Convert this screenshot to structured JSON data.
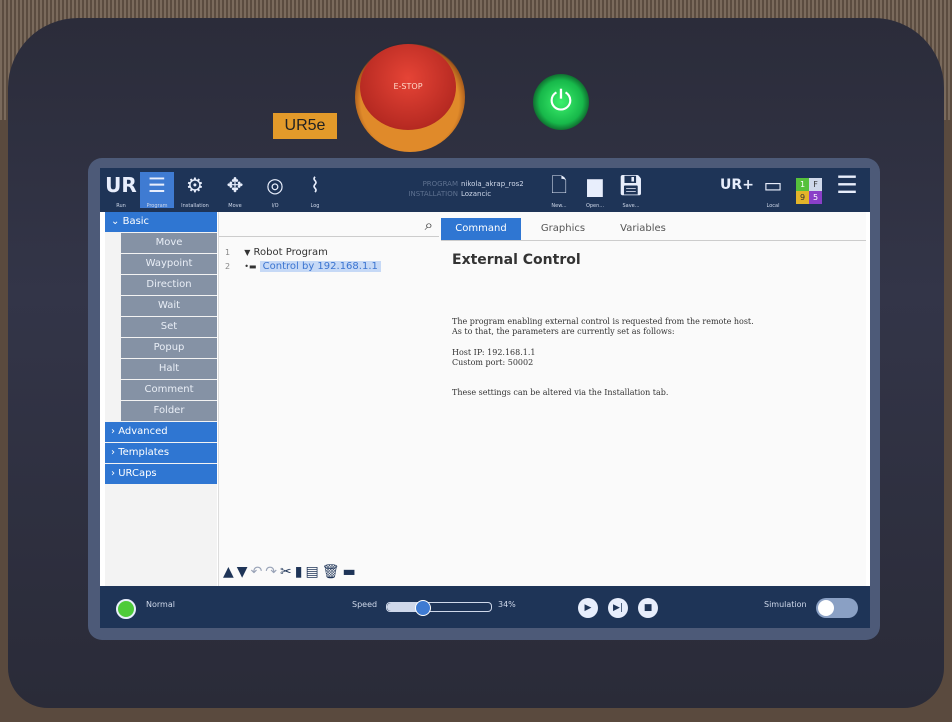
{
  "hardware": {
    "estop_label": "E-STOP",
    "model_label": "UR5e",
    "power_icon": "power-icon"
  },
  "header": {
    "tabs": [
      {
        "label": "Run",
        "icon": "ur-logo-icon"
      },
      {
        "label": "Program",
        "icon": "program-icon"
      },
      {
        "label": "Installation",
        "icon": "installation-icon"
      },
      {
        "label": "Move",
        "icon": "move-icon"
      },
      {
        "label": "I/O",
        "icon": "io-icon"
      },
      {
        "label": "Log",
        "icon": "log-icon"
      }
    ],
    "program_key": "PROGRAM",
    "program_value": "nikola_akrap_ros2",
    "installation_key": "INSTALLATION",
    "installation_value": "Lozancic",
    "file_buttons": [
      "New...",
      "Open...",
      "Save..."
    ],
    "local_label": "Local",
    "indicator": [
      "1",
      "F",
      "9",
      "5"
    ]
  },
  "sidebar": {
    "basic_label": "Basic",
    "items": [
      "Move",
      "Waypoint",
      "Direction",
      "Wait",
      "Set",
      "Popup",
      "Halt",
      "Comment",
      "Folder"
    ],
    "categories": [
      "Advanced",
      "Templates",
      "URCaps"
    ]
  },
  "tree": {
    "rows": [
      {
        "num": "1",
        "label": "Robot Program"
      },
      {
        "num": "2",
        "label": "Control by 192.168.1.1"
      }
    ]
  },
  "panel": {
    "tabs": [
      "Command",
      "Graphics",
      "Variables"
    ],
    "title": "External Control",
    "line1": "The program enabling external control is requested from the remote host.",
    "line2": "As to that, the parameters are currently set as follows:",
    "host_ip": "Host IP: 192.168.1.1",
    "custom_port": "Custom port: 50002",
    "line3": "These settings can be altered via the Installation tab."
  },
  "footer": {
    "status": "Normal",
    "speed_label": "Speed",
    "speed_value": "34%",
    "speed_fraction": 0.34,
    "simulation_label": "Simulation"
  },
  "colors": {
    "accent": "#2f76d2",
    "bar": "#1e3457",
    "status_ok": "#4ecb3a"
  }
}
